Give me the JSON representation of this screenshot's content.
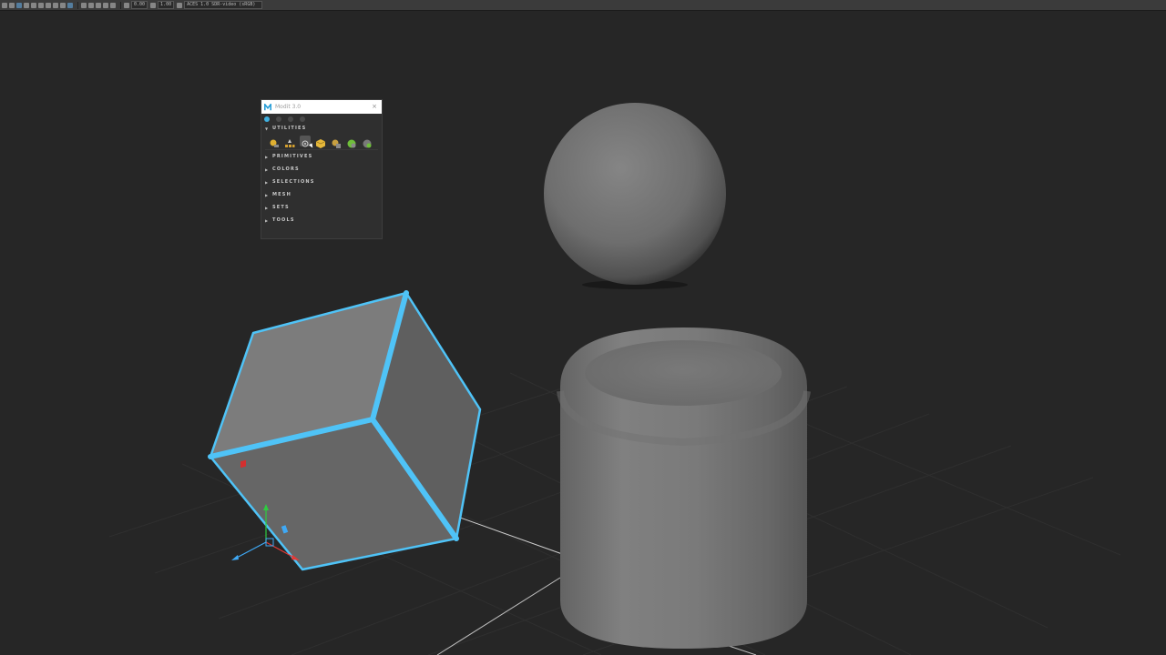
{
  "toolbar": {
    "field_1": "0.00",
    "field_2": "1.00",
    "colorspace": "ACES 1.0 SDR-video (sRGB)"
  },
  "panel": {
    "title": "Modit 3.0",
    "close": "×",
    "sections": [
      {
        "label": "UTILITIES",
        "expanded": true
      },
      {
        "label": "PRIMITIVES",
        "expanded": false
      },
      {
        "label": "COLORS",
        "expanded": false
      },
      {
        "label": "SELECTIONS",
        "expanded": false
      },
      {
        "label": "MESH",
        "expanded": false
      },
      {
        "label": "SETS",
        "expanded": false
      },
      {
        "label": "TOOLS",
        "expanded": false
      }
    ],
    "utility_icons": [
      "pivot-icon",
      "align-icon",
      "target-icon",
      "cube-icon",
      "grid-icon",
      "green-sphere-icon",
      "gray-sphere-icon"
    ]
  },
  "scene": {
    "objects": [
      "cube",
      "sphere",
      "cylinder"
    ],
    "selection_color": "#4fc3f7",
    "background": "#262626"
  }
}
